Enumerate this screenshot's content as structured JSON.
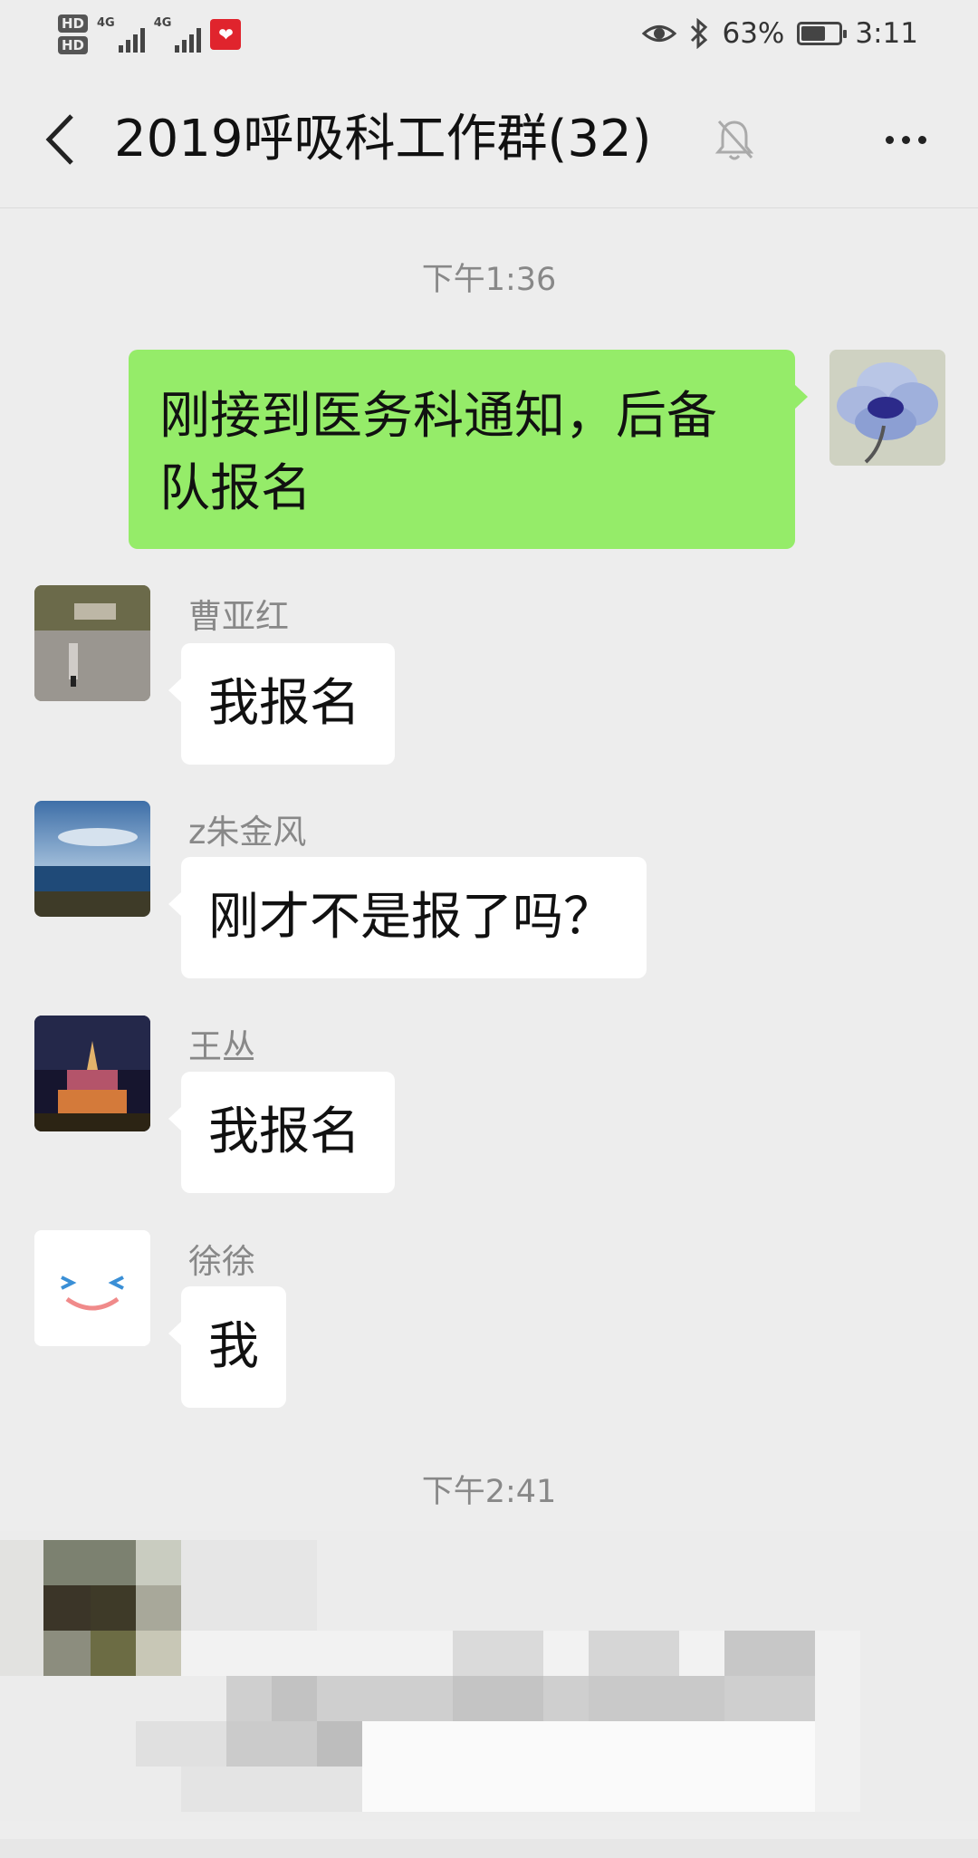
{
  "status_bar": {
    "hd1": "HD",
    "hd2": "HD",
    "sim1_net": "4G",
    "sim2_net": "4G",
    "battery_percent": "63%",
    "battery_level": 0.63,
    "time": "3:11"
  },
  "header": {
    "title": "2019呼吸科工作群(32)",
    "icons": {
      "back": "chevron-left-icon",
      "mute": "bell-off-icon",
      "more": "more-dots-icon"
    }
  },
  "timestamps": [
    "下午1:36",
    "下午2:41"
  ],
  "messages": [
    {
      "direction": "out",
      "sender": "",
      "text_line1": "刚接到医务科通知，后备",
      "text_line2": "队报名"
    },
    {
      "direction": "in",
      "sender": "曹亚红",
      "text": "我报名"
    },
    {
      "direction": "in",
      "sender": "z朱金风",
      "text": "刚才不是报了吗？"
    },
    {
      "direction": "in",
      "sender": "王丛",
      "text": "我报名"
    },
    {
      "direction": "in",
      "sender": "徐徐",
      "text": "我"
    }
  ],
  "colors": {
    "background": "#ededed",
    "outgoing_bubble": "#95ec69",
    "incoming_bubble": "#ffffff",
    "secondary_text": "#888888"
  }
}
